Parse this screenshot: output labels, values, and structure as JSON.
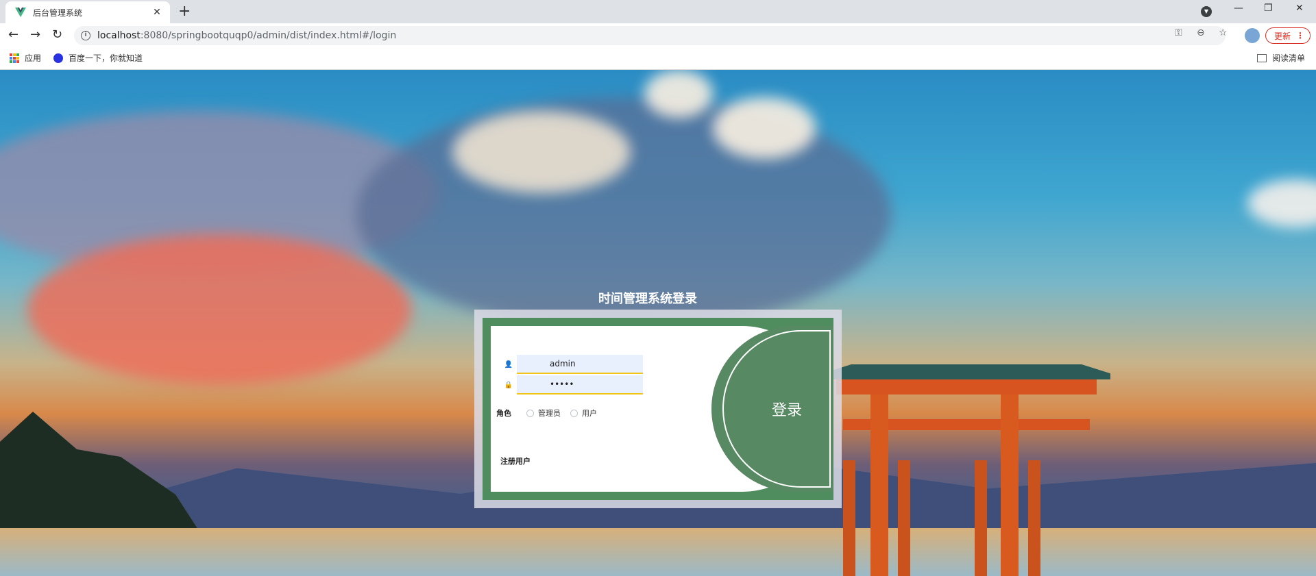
{
  "browser": {
    "tab_title": "后台管理系统",
    "url_host": "localhost",
    "url_rest": ":8080/springbootquqp0/admin/dist/index.html#/login",
    "update_label": "更新",
    "bookmarks": [
      {
        "label": "应用",
        "icon": "apps-icon"
      },
      {
        "label": "百度一下，你就知道",
        "icon": "baidu-icon"
      }
    ],
    "reading_list": "阅读清单"
  },
  "login": {
    "title": "时间管理系统登录",
    "username": "admin",
    "password": "•••••",
    "role_label": "角色",
    "roles": [
      "管理员",
      "用户"
    ],
    "login_button": "登录",
    "register_link": "注册用户"
  },
  "colors": {
    "accent_green": "#4f8d5e",
    "input_underline": "#f0c419",
    "input_bg": "#e8f0fe"
  }
}
